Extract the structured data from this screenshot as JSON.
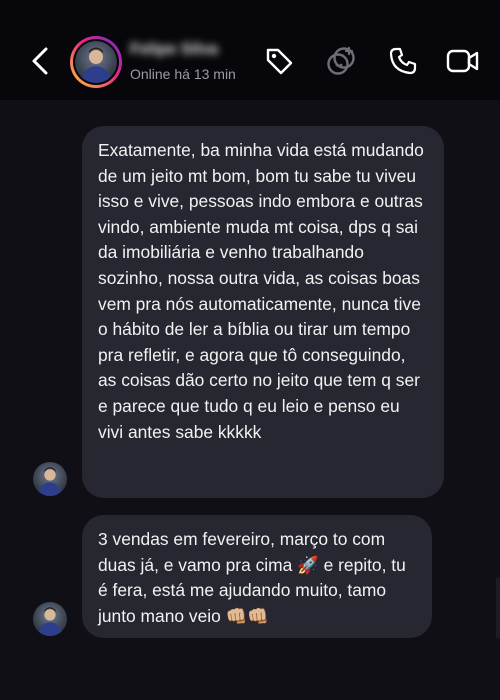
{
  "header": {
    "back_icon": "chevron-left-icon",
    "contact_name": "Felipe Silva",
    "status": "Online há 13 min",
    "icons": [
      "tag-icon",
      "effects-icon",
      "phone-icon",
      "video-icon"
    ]
  },
  "messages": [
    {
      "text": "Exatamente, ba minha vida está mudando de um jeito mt bom, bom tu sabe tu viveu isso e vive, pessoas indo embora e outras vindo, ambiente muda mt coisa, dps q sai da imobiliária e venho trabalhando sozinho, nossa outra vida, as coisas boas vem pra nós automaticamente, nunca tive o hábito de ler a bíblia ou tirar um tempo pra refletir, e agora que tô conseguindo, as coisas dão certo no jeito que tem q ser e parece que tudo q eu leio e penso eu vivi antes sabe kkkkk"
    },
    {
      "text": "3 vendas em fevereiro, março to com duas já, e vamo pra cima 🚀 e repito, tu é fera, está me ajudando muito, tamo junto mano veio 👊🏼👊🏼"
    }
  ],
  "colors": {
    "header_bg": "#07070b",
    "chat_bg": "#0f0f15",
    "bubble_bg": "#262731",
    "status_text": "#9b9ba2"
  }
}
